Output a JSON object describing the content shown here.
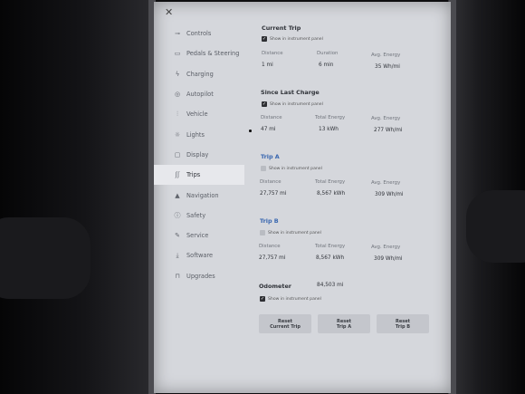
{
  "sidebar": {
    "items": [
      {
        "label": "Controls",
        "icon": "toggle-icon",
        "glyph": "⊸"
      },
      {
        "label": "Pedals & Steering",
        "icon": "car-icon",
        "glyph": "▭"
      },
      {
        "label": "Charging",
        "icon": "bolt-icon",
        "glyph": "ϟ"
      },
      {
        "label": "Autopilot",
        "icon": "steering-wheel-icon",
        "glyph": "◎"
      },
      {
        "label": "Vehicle",
        "icon": "sliders-icon",
        "glyph": "⫶"
      },
      {
        "label": "Lights",
        "icon": "bulb-icon",
        "glyph": "☼"
      },
      {
        "label": "Display",
        "icon": "display-icon",
        "glyph": "▢"
      },
      {
        "label": "Trips",
        "icon": "route-icon",
        "glyph": "ʃʃ"
      },
      {
        "label": "Navigation",
        "icon": "navigation-arrow-icon",
        "glyph": "▲"
      },
      {
        "label": "Safety",
        "icon": "safety-icon",
        "glyph": "ⓘ"
      },
      {
        "label": "Service",
        "icon": "wrench-icon",
        "glyph": "✎"
      },
      {
        "label": "Software",
        "icon": "download-icon",
        "glyph": "⤓"
      },
      {
        "label": "Upgrades",
        "icon": "bag-icon",
        "glyph": "⊓"
      }
    ],
    "active": "Trips"
  },
  "checkbox_label": "Show in instrument panel",
  "sections": {
    "current": {
      "title": "Current Trip",
      "checked": true,
      "labels": [
        "Distance",
        "Duration",
        "Avg. Energy"
      ],
      "values": [
        "1 mi",
        "6  min",
        "35 Wh/mi"
      ]
    },
    "since_charge": {
      "title": "Since Last Charge",
      "checked": true,
      "labels": [
        "Distance",
        "Total Energy",
        "Avg. Energy"
      ],
      "values": [
        "47 mi",
        "13 kWh",
        "277 Wh/mi"
      ]
    },
    "trip_a": {
      "title": "Trip A",
      "checked": false,
      "labels": [
        "Distance",
        "Total Energy",
        "Avg. Energy"
      ],
      "values": [
        "27,757 mi",
        "8,567 kWh",
        "309 Wh/mi"
      ]
    },
    "trip_b": {
      "title": "Trip B",
      "checked": false,
      "labels": [
        "Distance",
        "Total Energy",
        "Avg. Energy"
      ],
      "values": [
        "27,757 mi",
        "8,567 kWh",
        "309 Wh/mi"
      ]
    },
    "odometer": {
      "title": "Odometer",
      "value": "84,503  mi",
      "checked": true
    }
  },
  "buttons": [
    {
      "line1": "Reset",
      "line2": "Current Trip"
    },
    {
      "line1": "Reset",
      "line2": "Trip A"
    },
    {
      "line1": "Reset",
      "line2": "Trip B"
    }
  ],
  "close_glyph": "✕",
  "check_glyph": "✓"
}
